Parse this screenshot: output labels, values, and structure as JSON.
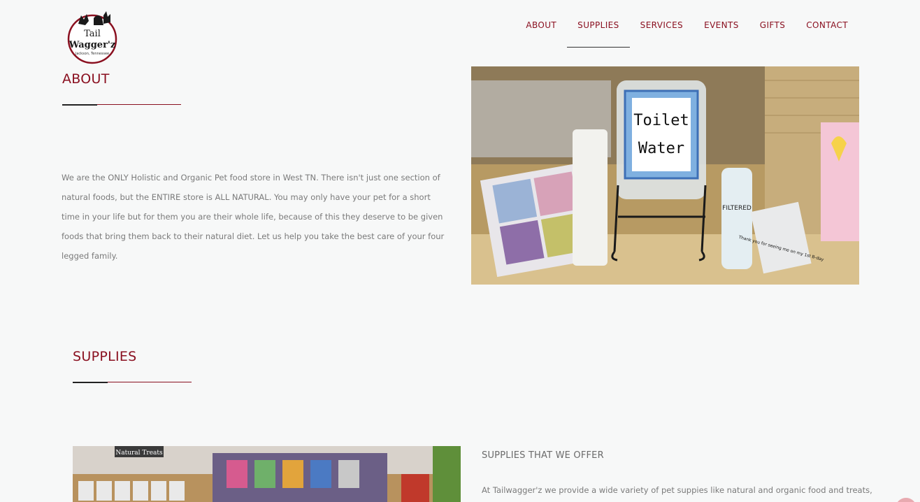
{
  "brand": {
    "logo_line1": "Tail",
    "logo_line2": "Wagger'z",
    "logo_line3": "Jackson, Tennessee"
  },
  "nav": {
    "items": [
      {
        "label": "ABOUT"
      },
      {
        "label": "SUPPLIES"
      },
      {
        "label": "SERVICES"
      },
      {
        "label": "EVENTS"
      },
      {
        "label": "GIFTS"
      },
      {
        "label": "CONTACT"
      }
    ],
    "active_index": 1
  },
  "about": {
    "title": "ABOUT",
    "body": "We are the ONLY Holistic and Organic Pet food store in West TN. There isn't just one section of natural foods, but the ENTIRE store is ALL NATURAL. You may only have your pet for a short time in your life but for them you are their whole life, because of this they deserve to be given foods that bring them back to their natural diet. Let us help you take the best care of your four legged family.",
    "photo": {
      "sign_line1": "Toilet",
      "sign_line2": "Water",
      "bottle_label": "FILTERED",
      "note_text": "Thank you for seeing me on my 1st B-day"
    }
  },
  "supplies": {
    "title": "SUPPLIES",
    "subheading": "SUPPLIES THAT WE OFFER",
    "body": "At Tailwagger'z we provide a wide variety of pet suppies like natural and organic food and treats,",
    "photo": {
      "sign_text": "Natural Treats"
    }
  },
  "colors": {
    "accent": "#8a1020",
    "background": "#f7f8f8",
    "text": "#7a7a7a"
  }
}
